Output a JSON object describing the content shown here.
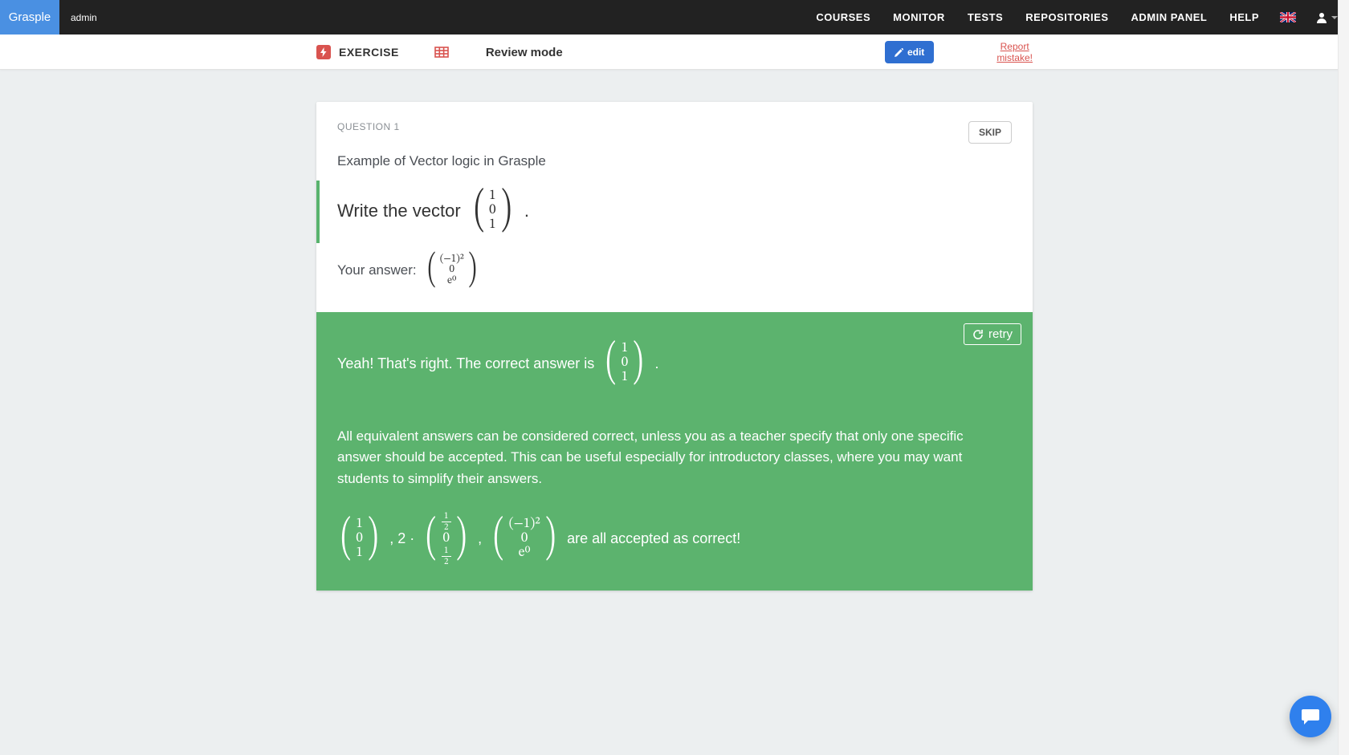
{
  "nav": {
    "brand": "Grasple",
    "role": "admin",
    "links": [
      "COURSES",
      "MONITOR",
      "TESTS",
      "REPOSITORIES",
      "ADMIN PANEL",
      "HELP"
    ]
  },
  "modebar": {
    "exercise_tag": "EXERCISE",
    "title": "Review mode",
    "edit_label": "edit",
    "report_label_l1": "Report",
    "report_label_l2": "mistake!"
  },
  "question": {
    "label": "QUESTION 1",
    "skip_label": "SKIP",
    "title": "Example of Vector logic in Grasple",
    "prompt_text": "Write the vector",
    "prompt_vec": [
      "1",
      "0",
      "1"
    ],
    "prompt_trail": ".",
    "your_answer_label": "Your answer:",
    "answer_vec": [
      "(−1)²",
      "0",
      "e⁰"
    ]
  },
  "feedback": {
    "retry_label": "retry",
    "head_pre": "Yeah! That's right. The correct answer is",
    "head_vec": [
      "1",
      "0",
      "1"
    ],
    "head_post": ".",
    "body": "All equivalent answers can be considered correct, unless you as a teacher specify that only one specific answer should be accepted. This can be useful especially for introductory classes, where you may want students to simplify their answers.",
    "ex_vec1": [
      "1",
      "0",
      "1"
    ],
    "ex_sep1": ", 2 ·",
    "ex_vec2_top_n": "1",
    "ex_vec2_top_d": "2",
    "ex_vec2_mid": "0",
    "ex_vec2_bot_n": "1",
    "ex_vec2_bot_d": "2",
    "ex_sep2": ",",
    "ex_vec3": [
      "(−1)²",
      "0",
      "e⁰"
    ],
    "ex_trail": "are all accepted as correct!"
  }
}
